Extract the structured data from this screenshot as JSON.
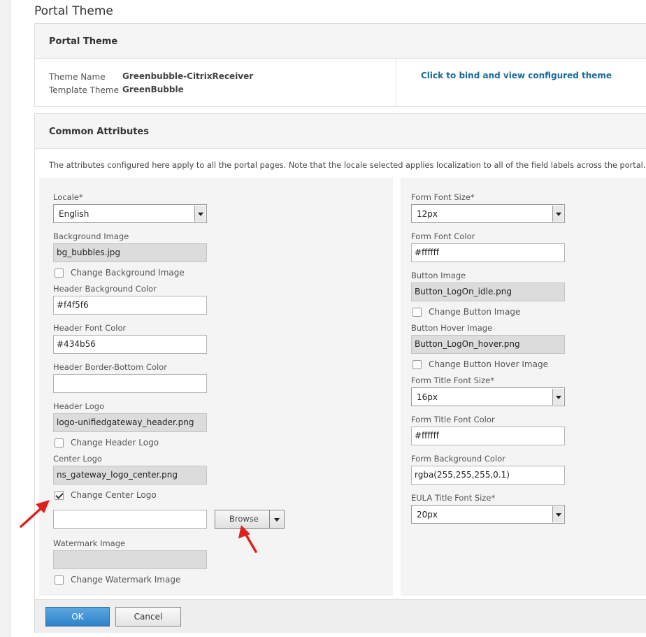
{
  "page": {
    "title": "Portal Theme"
  },
  "theme_panel": {
    "heading": "Portal Theme",
    "theme_name_label": "Theme Name",
    "theme_name_value": "Greenbubble-CitrixReceiver",
    "template_theme_label": "Template Theme",
    "template_theme_value": "GreenBubble",
    "bind_link": "Click to bind and view configured theme"
  },
  "attributes_panel": {
    "heading": "Common Attributes",
    "note": "The attributes configured here apply to all the portal pages. Note that the locale selected applies localization to all of the field labels across the portal.",
    "left": {
      "locale_label": "Locale*",
      "locale_value": "English",
      "bg_image_label": "Background Image",
      "bg_image_value": "bg_bubbles.jpg",
      "change_bg_image": "Change Background Image",
      "header_bg_color_label": "Header Background Color",
      "header_bg_color_value": "#f4f5f6",
      "header_font_color_label": "Header Font Color",
      "header_font_color_value": "#434b56",
      "header_border_label": "Header Border-Bottom Color",
      "header_border_value": "",
      "header_logo_label": "Header Logo",
      "header_logo_value": "logo-unifiedgateway_header.png",
      "change_header_logo": "Change Header Logo",
      "center_logo_label": "Center Logo",
      "center_logo_value": "ns_gateway_logo_center.png",
      "change_center_logo": "Change Center Logo",
      "change_center_logo_checked": true,
      "center_logo_file_value": "",
      "browse_label": "Browse",
      "watermark_label": "Watermark Image",
      "watermark_value": "",
      "change_watermark": "Change Watermark Image"
    },
    "right": {
      "form_font_size_label": "Form Font Size*",
      "form_font_size_value": "12px",
      "form_font_color_label": "Form Font Color",
      "form_font_color_value": "#ffffff",
      "button_image_label": "Button Image",
      "button_image_value": "Button_LogOn_idle.png",
      "change_button_image": "Change Button Image",
      "button_hover_label": "Button Hover Image",
      "button_hover_value": "Button_LogOn_hover.png",
      "change_button_hover": "Change Button Hover Image",
      "form_title_font_size_label": "Form Title Font Size*",
      "form_title_font_size_value": "16px",
      "form_title_font_color_label": "Form Title Font Color",
      "form_title_font_color_value": "#ffffff",
      "form_bg_color_label": "Form Background Color",
      "form_bg_color_value": "rgba(255,255,255,0.1)",
      "eula_title_font_size_label": "EULA Title Font Size*",
      "eula_title_font_size_value": "20px"
    }
  },
  "footer": {
    "ok_label": "OK",
    "cancel_label": "Cancel"
  },
  "colors": {
    "link": "#1a6b9a",
    "primary_button": "#2f82c8",
    "annotation_arrow": "#e0201c"
  }
}
